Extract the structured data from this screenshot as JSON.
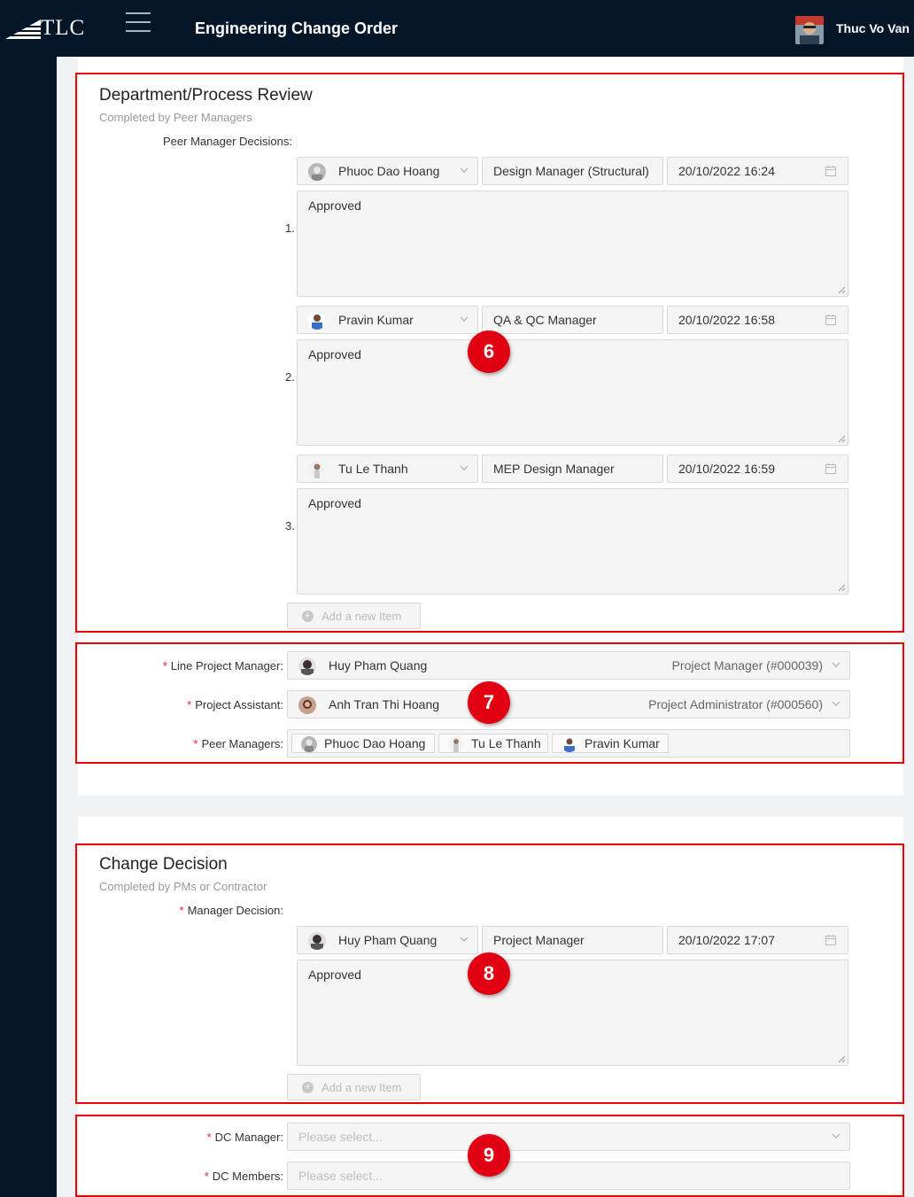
{
  "header": {
    "logo_text": "TLC",
    "app_title": "Engineering Change Order",
    "user_name": "Thuc Vo Van"
  },
  "dept_review": {
    "title": "Department/Process Review",
    "subtitle": "Completed by Peer Managers",
    "decisions_label": "Peer Manager Decisions",
    "rows": [
      {
        "num": "1.",
        "person": "Phuoc Dao Hoang",
        "role": "Design Manager (Structural)",
        "datetime": "20/10/2022 16:24",
        "comment": "Approved"
      },
      {
        "num": "2.",
        "person": "Pravin Kumar",
        "role": "QA & QC Manager",
        "datetime": "20/10/2022 16:58",
        "comment": "Approved"
      },
      {
        "num": "3.",
        "person": "Tu Le Thanh",
        "role": "MEP Design Manager",
        "datetime": "20/10/2022 16:59",
        "comment": "Approved"
      }
    ],
    "add_item": "Add a new Item"
  },
  "assignees": {
    "line_pm_label": "Line Project Manager",
    "line_pm_name": "Huy Pham Quang",
    "line_pm_role": "Project Manager (#000039)",
    "pa_label": "Project Assistant",
    "pa_name": "Anh Tran Thi Hoang",
    "pa_role": "Project Administrator (#000560)",
    "peers_label": "Peer Managers",
    "peers": [
      "Phuoc Dao Hoang",
      "Tu Le Thanh",
      "Pravin Kumar"
    ]
  },
  "change_decision": {
    "title": "Change Decision",
    "subtitle": "Completed by PMs or Contractor",
    "decision_label": "Manager Decision",
    "row": {
      "person": "Huy Pham Quang",
      "role": "Project Manager",
      "datetime": "20/10/2022 17:07",
      "comment": "Approved"
    },
    "add_item": "Add a new Item"
  },
  "dc": {
    "manager_label": "DC Manager",
    "manager_placeholder": "Please select...",
    "members_label": "DC Members",
    "members_placeholder": "Please select..."
  },
  "badges": [
    "6",
    "7",
    "8",
    "9"
  ],
  "colors": {
    "topbar": "#061629",
    "annotation": "#e00012",
    "required": "#f5222d"
  }
}
